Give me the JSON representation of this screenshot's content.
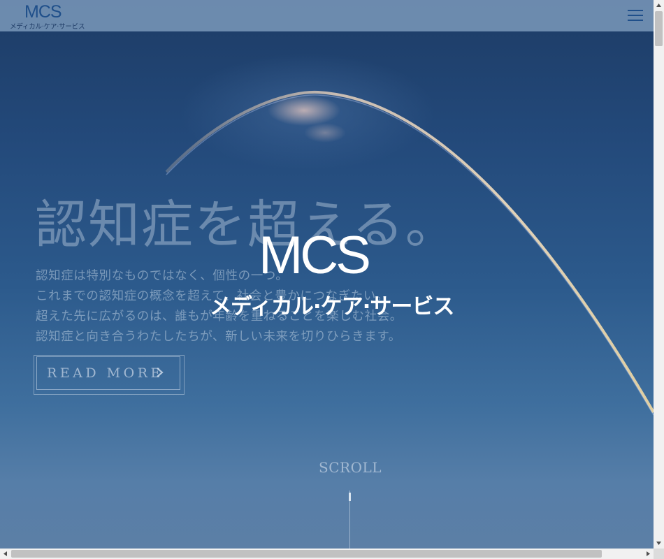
{
  "header": {
    "logo_text": "MCS",
    "logo_subtext": "メディカル·ケア·サービス",
    "menu_icon": "hamburger-menu-icon"
  },
  "hero": {
    "headline": "認知症を超える。",
    "body_lines": [
      "認知症は特別なものではなく、個性の一つ。",
      "これまでの認知症の概念を超えて、社会と豊かにつなぎたい。",
      "超えた先に広がるのは、誰もが年齢を重ねることを楽しむ社会。",
      "認知症と向き合うわたしたちが、新しい未来を切りひらきます。"
    ],
    "read_more_label": "READ MORE",
    "read_more_icon": "chevron-right-icon",
    "background_icon": "rainbow-arc-sky-image"
  },
  "center_logo": {
    "text": "MCS",
    "kana": "メディカル·ケア·サービス"
  },
  "scroll": {
    "label": "SCROLL"
  },
  "colors": {
    "header_bg": "#7391b4",
    "logo_blue": "#1f4f8a",
    "sky_top": "#1d3c66",
    "sky_bottom": "#5c7fa6"
  }
}
